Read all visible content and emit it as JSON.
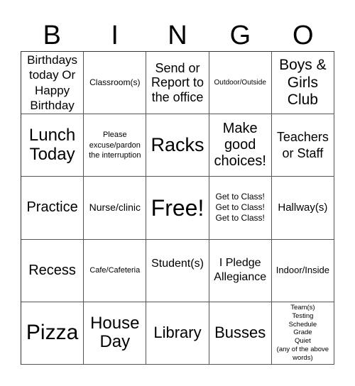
{
  "header": {
    "letters": [
      "B",
      "I",
      "N",
      "G",
      "O"
    ]
  },
  "cells": [
    [
      "Birthdays today Or Happy Birthday",
      "Classroom(s)",
      "Send or Report to the office",
      "Outdoor/Outside",
      "Boys & Girls Club"
    ],
    [
      "Lunch Today",
      "Please excuse/pardon the interruption",
      "Racks",
      "Make good choices!",
      "Teachers or Staff"
    ],
    [
      "Practice",
      "Nurse/clinic",
      "Free!",
      "Get to Class!\nGet to Class!\nGet to Class!",
      "Hallway(s)"
    ],
    [
      "Recess",
      "Cafe/Cafeteria",
      "Student(s)",
      "I Pledge Allegiance",
      "Indoor/Inside"
    ],
    [
      "Pizza",
      "House Day",
      "Library",
      "Busses",
      "Team(s)\nTesting\nSchedule\nGrade\nQuiet\n(any of the above words)"
    ]
  ]
}
